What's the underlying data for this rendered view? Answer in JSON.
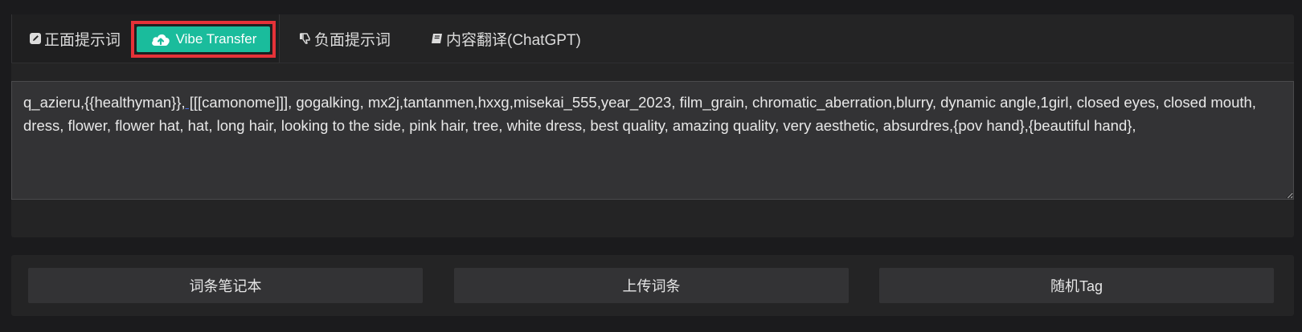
{
  "tabs": [
    {
      "label": "正面提示词",
      "icon": "pencil-square-icon"
    },
    {
      "label": "负面提示词",
      "icon": "thumbs-down-icon"
    },
    {
      "label": "内容翻译(ChatGPT)",
      "icon": "book-icon"
    }
  ],
  "vibe_button": {
    "label": "Vibe Transfer",
    "icon": "cloud-upload-icon",
    "color": "#1abc9c",
    "highlight_color": "#e53238"
  },
  "prompt": {
    "before_underline": "q_azieru,{{healthyman}}",
    "underlined": ", [",
    "after_underline": "[[camonome]]], gogalking, mx2j,tantanmen,hxxg,misekai_555,year_2023, film_grain, chromatic_aberration,blurry, dynamic angle,1girl, closed eyes, closed mouth, dress, flower, flower hat, hat, long hair, looking to the side, pink hair, tree, white dress, best quality, amazing quality, very aesthetic, absurdres,{pov hand},{beautiful hand},"
  },
  "bottom_buttons": [
    {
      "label": "词条笔记本"
    },
    {
      "label": "上传词条"
    },
    {
      "label": "随机Tag"
    }
  ]
}
